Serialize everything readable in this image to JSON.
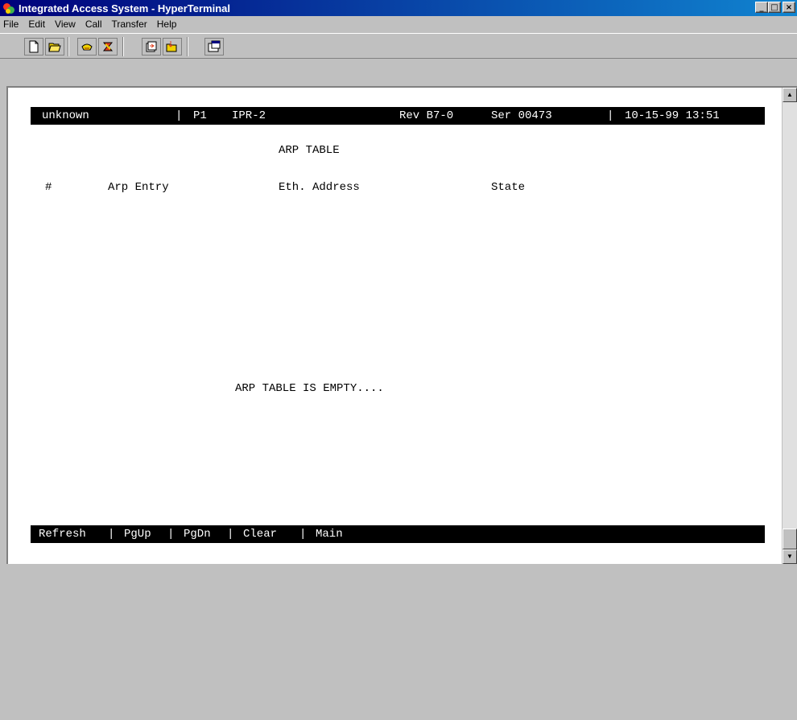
{
  "window": {
    "title": "Integrated Access System - HyperTerminal",
    "controls": {
      "minimize": "_",
      "maximize": "□",
      "close": "×"
    }
  },
  "menu": [
    "File",
    "Edit",
    "View",
    "Call",
    "Transfer",
    "Help"
  ],
  "toolbar": {
    "buttons": [
      "new-icon",
      "open-icon",
      "call-icon",
      "disconnect-icon",
      "send-icon",
      "receive-icon",
      "properties-icon"
    ]
  },
  "terminal": {
    "status": {
      "host": "unknown",
      "port_sep": "|",
      "port": "P1",
      "module": "IPR-2",
      "rev": "Rev B7-0",
      "serial": "Ser 00473",
      "date_sep": "|",
      "datetime": "10-15-99 13:51"
    },
    "screen_title": "ARP TABLE",
    "columns": [
      "#",
      "Arp Entry",
      "Eth. Address",
      "State"
    ],
    "message": "ARP TABLE IS EMPTY....",
    "commands": {
      "refresh": "Refresh",
      "pgup": "PgUp",
      "pgdn": "PgDn",
      "clear": "Clear",
      "main": "Main",
      "sep": "|"
    }
  },
  "colors": {
    "titlebar_start": "#00007a",
    "titlebar_end": "#1084d0",
    "terminal_bg": "#ffffff",
    "bar_bg": "#000000"
  }
}
